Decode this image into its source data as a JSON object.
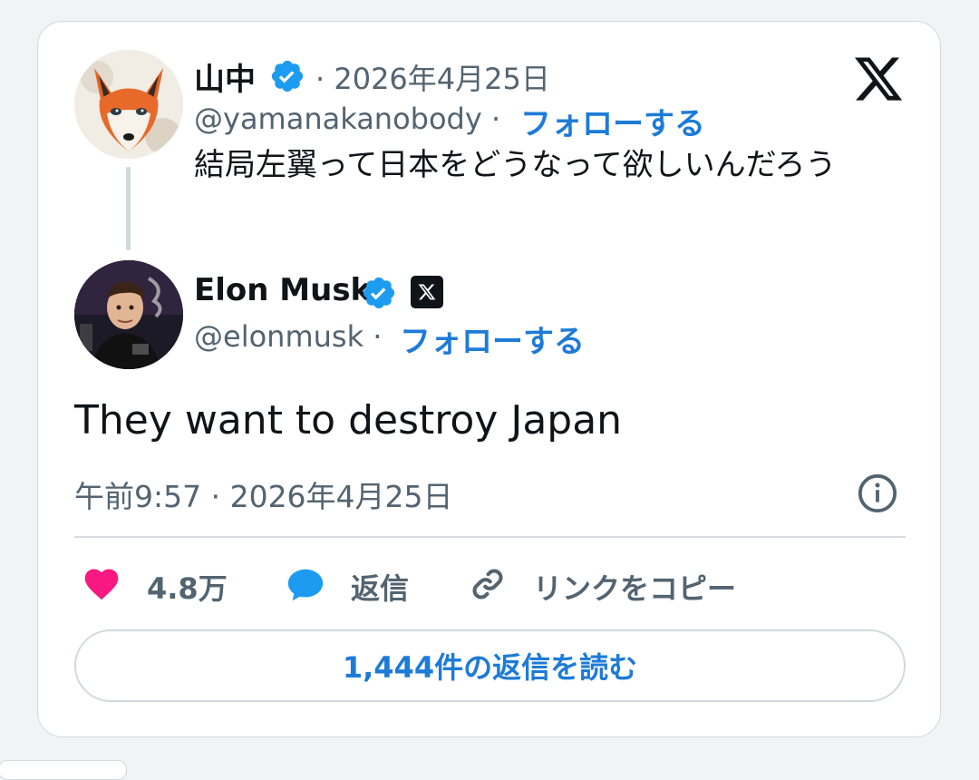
{
  "parent_tweet": {
    "name": "山中",
    "separator_date": "· 2026年4月25日",
    "handle": "@yamanakanobody ·",
    "follow_label": "フォローする",
    "text": "結局左翼って日本をどうなって欲しいんだろう"
  },
  "main_tweet": {
    "name": "Elon Musk",
    "handle": "@elonmusk ·",
    "follow_label": "フォローする",
    "text": "They want to destroy Japan",
    "timestamp": "午前9:57 · 2026年4月25日"
  },
  "actions": {
    "like_count": "4.8万",
    "reply_label": "返信",
    "copy_link_label": "リンクをコピー"
  },
  "read_replies_label": "1,444件の返信を読む",
  "icons": {
    "brand": "x-logo-icon",
    "verified": "verified-badge-icon",
    "like": "heart-icon",
    "reply": "speech-bubble-icon",
    "link": "link-icon",
    "info": "info-icon"
  },
  "colors": {
    "accent": "#1d7bd8",
    "verified": "#1d9bf0",
    "like": "#f91880",
    "muted": "#536471"
  }
}
